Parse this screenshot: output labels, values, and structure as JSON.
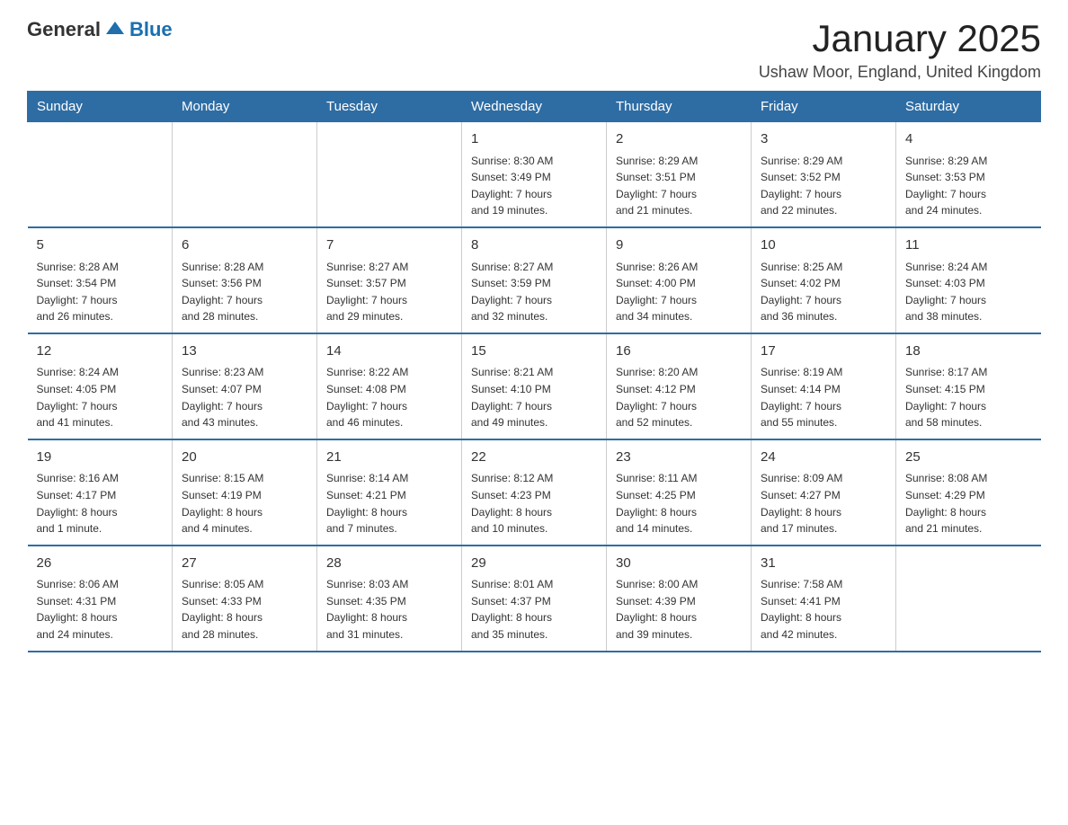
{
  "logo": {
    "general": "General",
    "blue": "Blue"
  },
  "title": "January 2025",
  "location": "Ushaw Moor, England, United Kingdom",
  "days_of_week": [
    "Sunday",
    "Monday",
    "Tuesday",
    "Wednesday",
    "Thursday",
    "Friday",
    "Saturday"
  ],
  "weeks": [
    [
      {
        "day": "",
        "info": ""
      },
      {
        "day": "",
        "info": ""
      },
      {
        "day": "",
        "info": ""
      },
      {
        "day": "1",
        "info": "Sunrise: 8:30 AM\nSunset: 3:49 PM\nDaylight: 7 hours\nand 19 minutes."
      },
      {
        "day": "2",
        "info": "Sunrise: 8:29 AM\nSunset: 3:51 PM\nDaylight: 7 hours\nand 21 minutes."
      },
      {
        "day": "3",
        "info": "Sunrise: 8:29 AM\nSunset: 3:52 PM\nDaylight: 7 hours\nand 22 minutes."
      },
      {
        "day": "4",
        "info": "Sunrise: 8:29 AM\nSunset: 3:53 PM\nDaylight: 7 hours\nand 24 minutes."
      }
    ],
    [
      {
        "day": "5",
        "info": "Sunrise: 8:28 AM\nSunset: 3:54 PM\nDaylight: 7 hours\nand 26 minutes."
      },
      {
        "day": "6",
        "info": "Sunrise: 8:28 AM\nSunset: 3:56 PM\nDaylight: 7 hours\nand 28 minutes."
      },
      {
        "day": "7",
        "info": "Sunrise: 8:27 AM\nSunset: 3:57 PM\nDaylight: 7 hours\nand 29 minutes."
      },
      {
        "day": "8",
        "info": "Sunrise: 8:27 AM\nSunset: 3:59 PM\nDaylight: 7 hours\nand 32 minutes."
      },
      {
        "day": "9",
        "info": "Sunrise: 8:26 AM\nSunset: 4:00 PM\nDaylight: 7 hours\nand 34 minutes."
      },
      {
        "day": "10",
        "info": "Sunrise: 8:25 AM\nSunset: 4:02 PM\nDaylight: 7 hours\nand 36 minutes."
      },
      {
        "day": "11",
        "info": "Sunrise: 8:24 AM\nSunset: 4:03 PM\nDaylight: 7 hours\nand 38 minutes."
      }
    ],
    [
      {
        "day": "12",
        "info": "Sunrise: 8:24 AM\nSunset: 4:05 PM\nDaylight: 7 hours\nand 41 minutes."
      },
      {
        "day": "13",
        "info": "Sunrise: 8:23 AM\nSunset: 4:07 PM\nDaylight: 7 hours\nand 43 minutes."
      },
      {
        "day": "14",
        "info": "Sunrise: 8:22 AM\nSunset: 4:08 PM\nDaylight: 7 hours\nand 46 minutes."
      },
      {
        "day": "15",
        "info": "Sunrise: 8:21 AM\nSunset: 4:10 PM\nDaylight: 7 hours\nand 49 minutes."
      },
      {
        "day": "16",
        "info": "Sunrise: 8:20 AM\nSunset: 4:12 PM\nDaylight: 7 hours\nand 52 minutes."
      },
      {
        "day": "17",
        "info": "Sunrise: 8:19 AM\nSunset: 4:14 PM\nDaylight: 7 hours\nand 55 minutes."
      },
      {
        "day": "18",
        "info": "Sunrise: 8:17 AM\nSunset: 4:15 PM\nDaylight: 7 hours\nand 58 minutes."
      }
    ],
    [
      {
        "day": "19",
        "info": "Sunrise: 8:16 AM\nSunset: 4:17 PM\nDaylight: 8 hours\nand 1 minute."
      },
      {
        "day": "20",
        "info": "Sunrise: 8:15 AM\nSunset: 4:19 PM\nDaylight: 8 hours\nand 4 minutes."
      },
      {
        "day": "21",
        "info": "Sunrise: 8:14 AM\nSunset: 4:21 PM\nDaylight: 8 hours\nand 7 minutes."
      },
      {
        "day": "22",
        "info": "Sunrise: 8:12 AM\nSunset: 4:23 PM\nDaylight: 8 hours\nand 10 minutes."
      },
      {
        "day": "23",
        "info": "Sunrise: 8:11 AM\nSunset: 4:25 PM\nDaylight: 8 hours\nand 14 minutes."
      },
      {
        "day": "24",
        "info": "Sunrise: 8:09 AM\nSunset: 4:27 PM\nDaylight: 8 hours\nand 17 minutes."
      },
      {
        "day": "25",
        "info": "Sunrise: 8:08 AM\nSunset: 4:29 PM\nDaylight: 8 hours\nand 21 minutes."
      }
    ],
    [
      {
        "day": "26",
        "info": "Sunrise: 8:06 AM\nSunset: 4:31 PM\nDaylight: 8 hours\nand 24 minutes."
      },
      {
        "day": "27",
        "info": "Sunrise: 8:05 AM\nSunset: 4:33 PM\nDaylight: 8 hours\nand 28 minutes."
      },
      {
        "day": "28",
        "info": "Sunrise: 8:03 AM\nSunset: 4:35 PM\nDaylight: 8 hours\nand 31 minutes."
      },
      {
        "day": "29",
        "info": "Sunrise: 8:01 AM\nSunset: 4:37 PM\nDaylight: 8 hours\nand 35 minutes."
      },
      {
        "day": "30",
        "info": "Sunrise: 8:00 AM\nSunset: 4:39 PM\nDaylight: 8 hours\nand 39 minutes."
      },
      {
        "day": "31",
        "info": "Sunrise: 7:58 AM\nSunset: 4:41 PM\nDaylight: 8 hours\nand 42 minutes."
      },
      {
        "day": "",
        "info": ""
      }
    ]
  ]
}
